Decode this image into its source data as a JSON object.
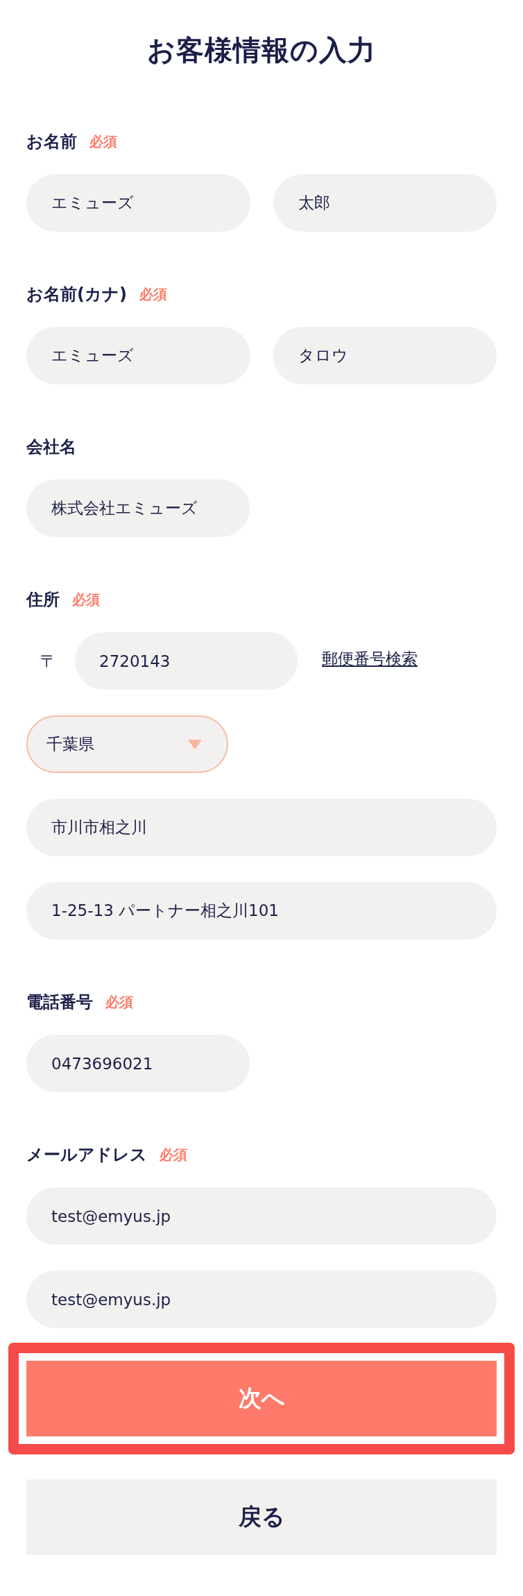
{
  "title": "お客様情報の入力",
  "sections": [
    {
      "label": "お名前",
      "badge": "必須",
      "rows": [
        {
          "kind": "pair",
          "values": [
            "エミューズ",
            "太郎"
          ]
        }
      ]
    },
    {
      "label": "お名前(カナ)",
      "badge": "必須",
      "rows": [
        {
          "kind": "pair",
          "values": [
            "エミューズ",
            "タロウ"
          ]
        }
      ]
    },
    {
      "label": "会社名",
      "rows": [
        {
          "kind": "half",
          "value": "株式会社エミューズ"
        }
      ]
    },
    {
      "label": "住所",
      "badge": "必須",
      "rows": [
        {
          "kind": "postal",
          "prefix": "〒",
          "value": "2720143",
          "link": "郵便番号検索"
        },
        {
          "kind": "select",
          "value": "千葉県"
        },
        {
          "kind": "full",
          "value": "市川市相之川"
        },
        {
          "kind": "full",
          "value": "1-25-13 パートナー相之川101"
        }
      ]
    },
    {
      "label": "電話番号",
      "badge": "必須",
      "rows": [
        {
          "kind": "half",
          "value": "0473696021"
        }
      ]
    },
    {
      "label": "メールアドレス",
      "badge": "必須",
      "rows": [
        {
          "kind": "full",
          "value": "test@emyus.jp"
        },
        {
          "kind": "full",
          "value": "test@emyus.jp"
        }
      ]
    }
  ],
  "buttons": [
    {
      "kind": "primary",
      "label": "次へ",
      "highlighted": true
    },
    {
      "kind": "secondary",
      "label": "戻る",
      "highlighted": false
    }
  ]
}
